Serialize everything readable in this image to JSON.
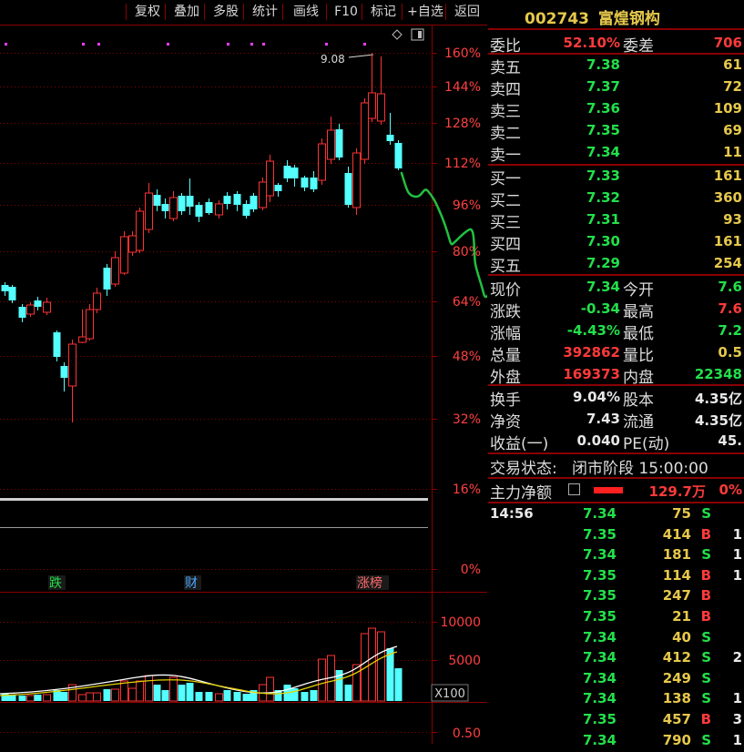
{
  "toolbar": {
    "items": [
      "复权",
      "叠加",
      "多股",
      "统计",
      "画线",
      "F10",
      "标记",
      "+自选",
      "返回"
    ]
  },
  "stock": {
    "code": "002743",
    "name": "富煌钢构"
  },
  "order_ratio": {
    "label_ratio": "委比",
    "ratio": "52.10%",
    "label_diff": "委差",
    "diff": "706"
  },
  "asks": [
    {
      "label": "卖五",
      "price": "7.38",
      "vol": "61"
    },
    {
      "label": "卖四",
      "price": "7.37",
      "vol": "72"
    },
    {
      "label": "卖三",
      "price": "7.36",
      "vol": "109"
    },
    {
      "label": "卖二",
      "price": "7.35",
      "vol": "69"
    },
    {
      "label": "卖一",
      "price": "7.34",
      "vol": "11"
    }
  ],
  "bids": [
    {
      "label": "买一",
      "price": "7.33",
      "vol": "161"
    },
    {
      "label": "买二",
      "price": "7.32",
      "vol": "360"
    },
    {
      "label": "买三",
      "price": "7.31",
      "vol": "93"
    },
    {
      "label": "买四",
      "price": "7.30",
      "vol": "161"
    },
    {
      "label": "买五",
      "price": "7.29",
      "vol": "254"
    }
  ],
  "quote": [
    {
      "l1": "现价",
      "v1": "7.34",
      "l2": "今开",
      "v2": "7.6"
    },
    {
      "l1": "涨跌",
      "v1": "-0.34",
      "l2": "最高",
      "v2": "7.6"
    },
    {
      "l1": "涨幅",
      "v1": "-4.43%",
      "l2": "最低",
      "v2": "7.2"
    },
    {
      "l1": "总量",
      "v1": "392862",
      "l2": "量比",
      "v2": "0.5"
    },
    {
      "l1": "外盘",
      "v1": "169373",
      "l2": "内盘",
      "v2": "22348"
    }
  ],
  "fundamentals": [
    {
      "l1": "换手",
      "v1": "9.04%",
      "l2": "股本",
      "v2": "4.35亿"
    },
    {
      "l1": "净资",
      "v1": "7.43",
      "l2": "流通",
      "v2": "4.35亿"
    },
    {
      "l1": "收益(一)",
      "v1": "0.040",
      "l2": "PE(动)",
      "v2": "45."
    }
  ],
  "status": {
    "label": "交易状态:",
    "value": "闭市阶段 15:00:00"
  },
  "main_flow": {
    "label": "主力净额",
    "value": "129.7万",
    "pct": "0%"
  },
  "ticks": [
    {
      "time": "14:56",
      "price": "7.34",
      "vol": "75",
      "side": "S",
      "n": ""
    },
    {
      "time": "",
      "price": "7.35",
      "vol": "414",
      "side": "B",
      "n": "1"
    },
    {
      "time": "",
      "price": "7.34",
      "vol": "181",
      "side": "S",
      "n": "1"
    },
    {
      "time": "",
      "price": "7.35",
      "vol": "114",
      "side": "B",
      "n": "1"
    },
    {
      "time": "",
      "price": "7.35",
      "vol": "247",
      "side": "B",
      "n": ""
    },
    {
      "time": "",
      "price": "7.35",
      "vol": "21",
      "side": "B",
      "n": ""
    },
    {
      "time": "",
      "price": "7.34",
      "vol": "40",
      "side": "S",
      "n": ""
    },
    {
      "time": "",
      "price": "7.34",
      "vol": "412",
      "side": "S",
      "n": "2"
    },
    {
      "time": "",
      "price": "7.34",
      "vol": "249",
      "side": "S",
      "n": ""
    },
    {
      "time": "",
      "price": "7.34",
      "vol": "138",
      "side": "S",
      "n": "1"
    },
    {
      "time": "",
      "price": "7.35",
      "vol": "457",
      "side": "B",
      "n": "3"
    },
    {
      "time": "",
      "price": "7.34",
      "vol": "790",
      "side": "S",
      "n": "1"
    }
  ],
  "chart_data": {
    "type": "candlestick",
    "y_axis_labels": [
      "160%",
      "144%",
      "128%",
      "112%",
      "96%",
      "80%",
      "64%",
      "48%",
      "32%",
      "16%",
      "0%"
    ],
    "high_marker": "9.08",
    "event_tags": [
      "跌",
      "财",
      "涨榜"
    ],
    "volume_axis_labels": [
      "10000",
      "5000"
    ],
    "volume_unit": "X100",
    "indicator_axis_label": "0.50",
    "colors": {
      "up": "#ff3232",
      "down": "#54ffff",
      "grid": "#8a0000",
      "axis_text": "#ff4040",
      "ma1": "#ffffff",
      "ma2": "#e6d200",
      "annotation": "#22c040"
    }
  }
}
